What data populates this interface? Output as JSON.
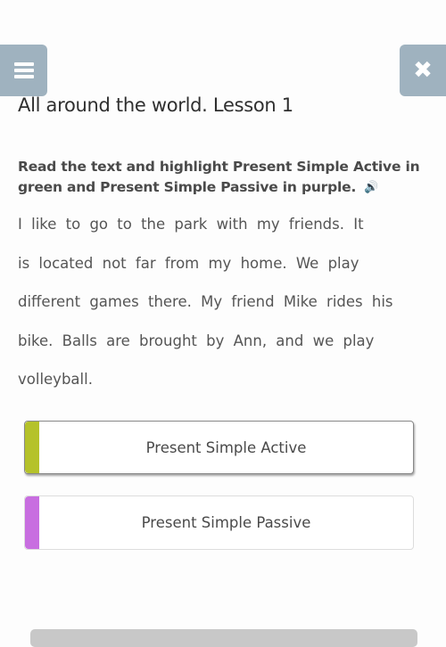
{
  "header": {
    "menu_icon": "hamburger-menu-icon",
    "close_icon": "close-x-icon",
    "close_glyph": "✖"
  },
  "lesson": {
    "title": "All around the world. Lesson 1"
  },
  "task": {
    "instruction": "Read the text and highlight Present Simple Active in green and Present Simple Passive in purple.",
    "audio_icon": "speaker-icon",
    "audio_glyph": "🔊"
  },
  "passage": {
    "lines": [
      "I like to go to the park with my friends. It",
      "is located not far from my home. We play",
      "different games there. My friend Mike rides his",
      "bike. Balls are brought by Ann, and we play",
      "volleyball."
    ]
  },
  "options": [
    {
      "label": "Present Simple Active",
      "color": "#b5c22a",
      "selected": true
    },
    {
      "label": "Present Simple Passive",
      "color": "#c86ee0",
      "selected": false
    }
  ],
  "colors": {
    "button_bg": "#9fb2bf",
    "active_green": "#b5c22a",
    "passive_purple": "#c86ee0"
  }
}
